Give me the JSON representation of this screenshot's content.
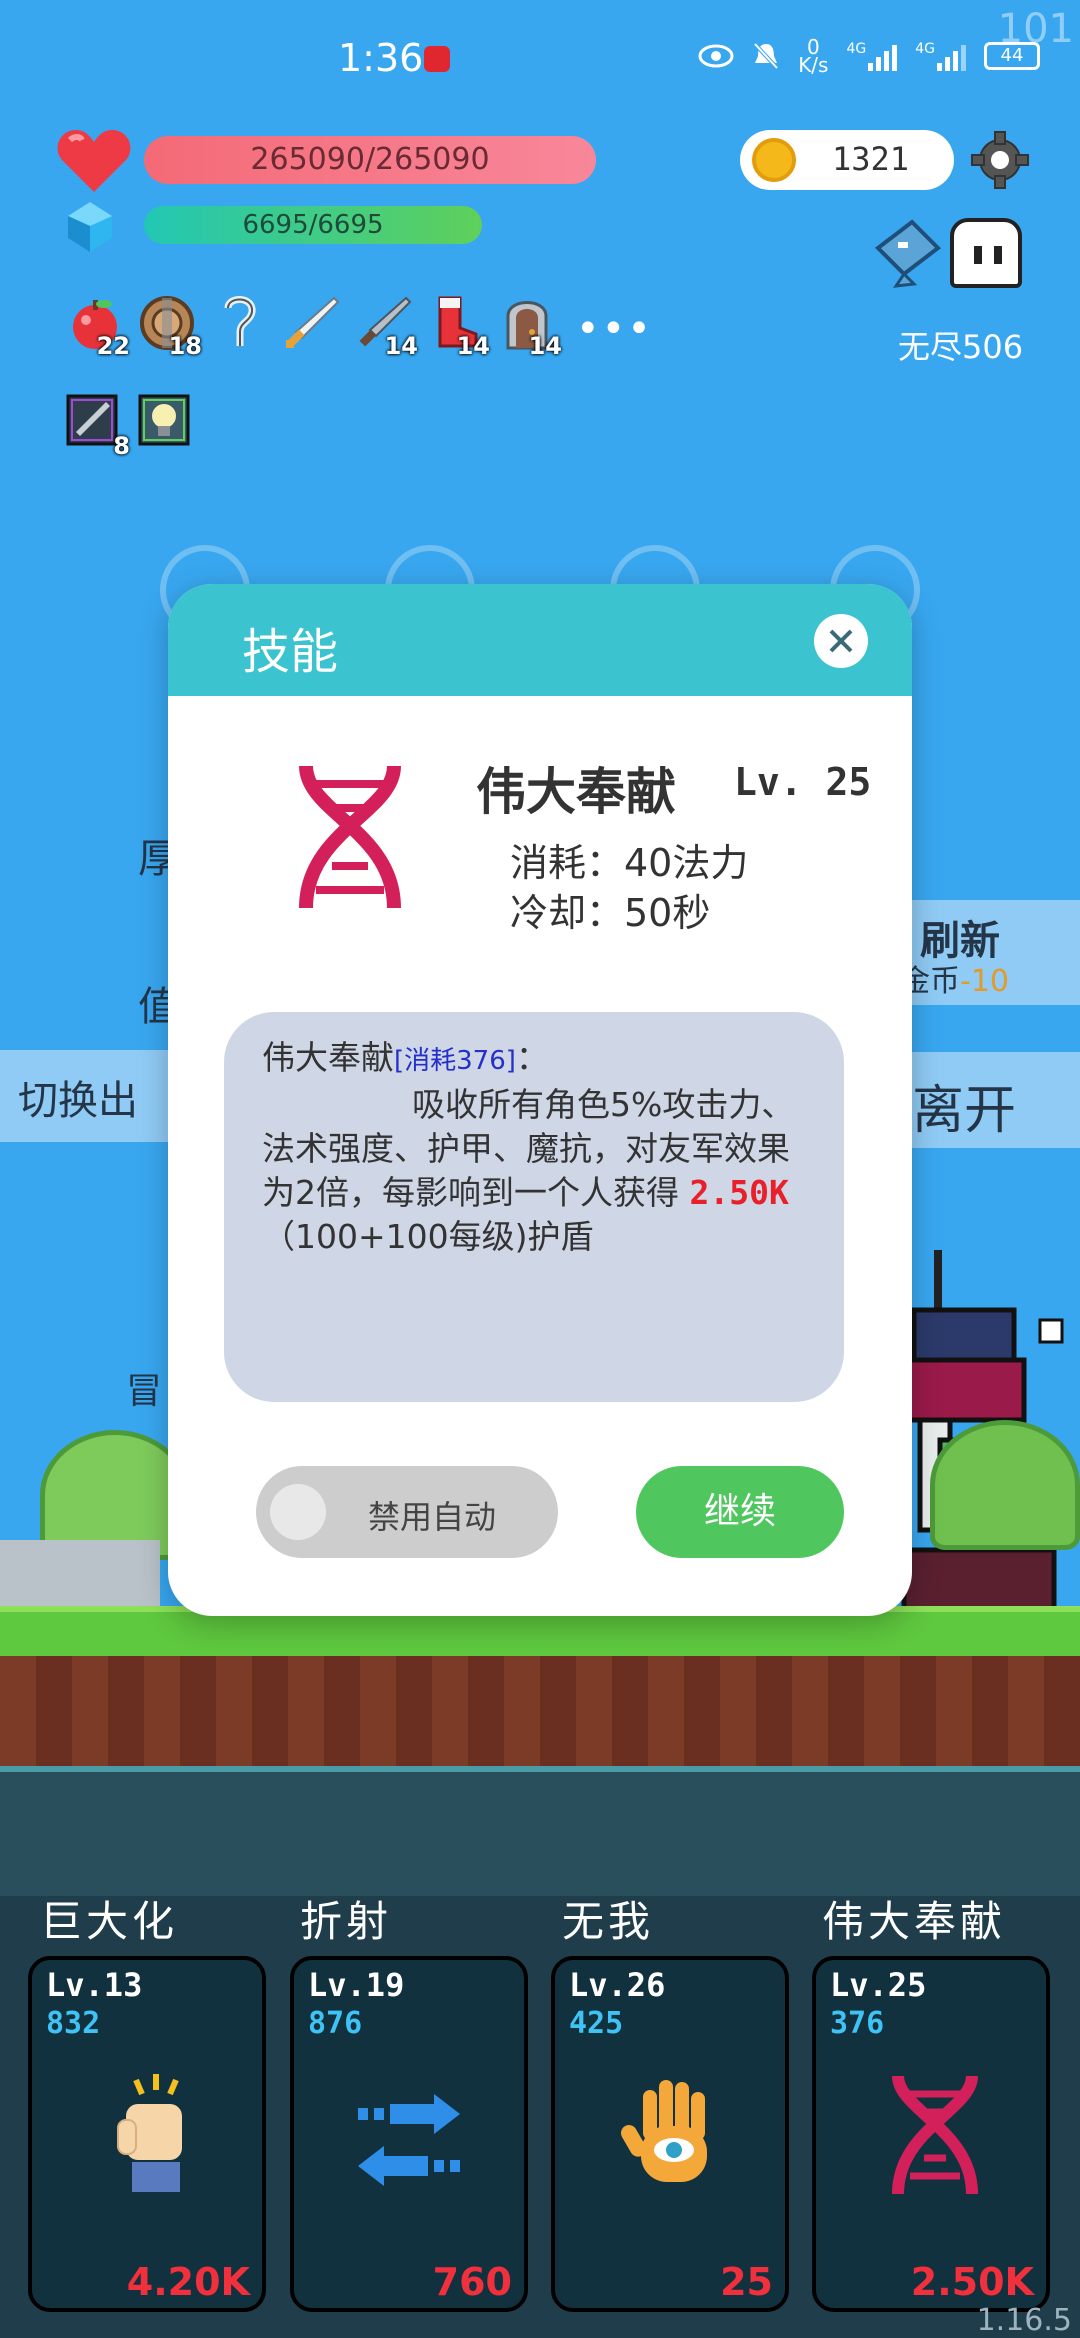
{
  "status_bar": {
    "time": "1:36",
    "net_speed_value": "0",
    "net_speed_unit": "K/s",
    "signal1_label": "4G",
    "signal2_label": "4G",
    "battery": "44",
    "corner_number": "101"
  },
  "hud": {
    "hp": "265090/265090",
    "mp": "6695/6695",
    "coins": "1321",
    "mode_label": "无尽506",
    "items": [
      {
        "name": "apple-icon",
        "badge": "22",
        "color": "#e8323a"
      },
      {
        "name": "shield-icon",
        "badge": "18",
        "color": "#b68656"
      },
      {
        "name": "hook-icon",
        "badge": "",
        "color": "#d8e6ee"
      },
      {
        "name": "sword-icon",
        "badge": "",
        "color": "#e8eef2"
      },
      {
        "name": "blade-icon",
        "badge": "14",
        "color": "#9aa3ad"
      },
      {
        "name": "boot-icon",
        "badge": "14",
        "color": "#e8323a"
      },
      {
        "name": "door-icon",
        "badge": "14",
        "color": "#8a5a44"
      }
    ],
    "more": "•••",
    "items_row2": [
      {
        "name": "sword-card-icon",
        "badge": "8"
      },
      {
        "name": "bulb-card-icon",
        "badge": ""
      }
    ]
  },
  "background": {
    "refresh_label": "刷新",
    "refresh_cost_prefix": "金币",
    "refresh_cost_value": "-10",
    "switch_label": "切换出",
    "leave_label": "离开",
    "side_chars": [
      "厚",
      "值",
      "冒"
    ]
  },
  "dialog": {
    "title": "技能",
    "skill_name": "伟大奉献",
    "skill_level": "Lv. 25",
    "cost_line": "消耗：40法力",
    "cd_line": "冷却：50秒",
    "desc_name": "伟大奉献",
    "desc_cost": "[消耗376]",
    "desc_colon": "：",
    "desc_body": "吸收所有角色5%攻击力、法术强度、护甲、魔抗，对友军效果为2倍，每影响到一个人获得",
    "desc_shield": "2.50K",
    "desc_tail": "（100+100每级)护盾",
    "toggle_label": "禁用自动",
    "continue_label": "继续"
  },
  "skills": [
    {
      "title": "巨大化",
      "level": "Lv.13",
      "cost": "832",
      "value": "4.20K",
      "icon": "fist-icon"
    },
    {
      "title": "折射",
      "level": "Lv.19",
      "cost": "876",
      "value": "760",
      "icon": "arrows-icon"
    },
    {
      "title": "无我",
      "level": "Lv.26",
      "cost": "425",
      "value": "25",
      "icon": "eye-hand-icon"
    },
    {
      "title": "伟大奉献",
      "level": "Lv.25",
      "cost": "376",
      "value": "2.50K",
      "icon": "dna-icon"
    }
  ],
  "version": "1.16.5",
  "colors": {
    "sky": "#38a7f0",
    "dialog_header": "#3bc3cf",
    "continue": "#4fc75e",
    "danger": "#f0303c",
    "skill_cost": "#3fc3f5"
  }
}
